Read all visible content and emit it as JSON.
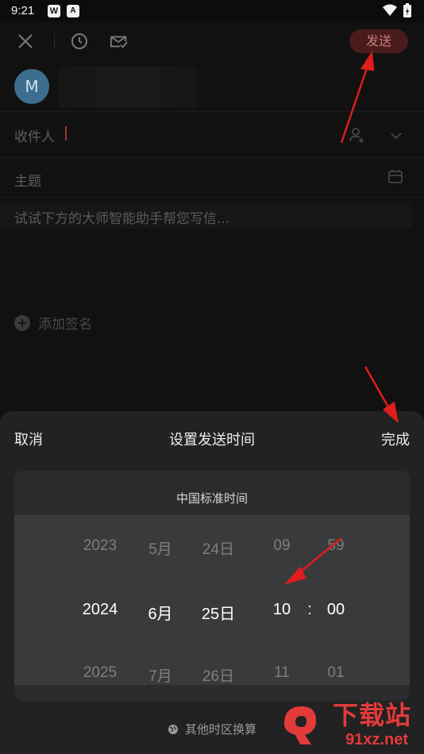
{
  "status_bar": {
    "time": "9:21",
    "app_icon_1": "W",
    "app_icon_2": "A"
  },
  "toolbar": {
    "send_label": "发送"
  },
  "sender": {
    "avatar_letter": "M"
  },
  "fields": {
    "recipient_label": "收件人",
    "subject_label": "主题",
    "body_placeholder": "试试下方的大师智能助手帮您写信...",
    "signature_label": "添加签名"
  },
  "sheet": {
    "cancel_label": "取消",
    "title": "设置发送时间",
    "done_label": "完成",
    "timezone_label": "中国标准时间",
    "timezone_convert_label": "其他时区换算",
    "wheels": {
      "years": [
        "2023",
        "2024",
        "2025"
      ],
      "months": [
        "5月",
        "6月",
        "7月"
      ],
      "days": [
        "24日",
        "25日",
        "26日"
      ],
      "hours": [
        "09",
        "10",
        "11"
      ],
      "colon": ":",
      "minutes": [
        "59",
        "00",
        "01"
      ]
    }
  },
  "watermark": {
    "top": "下载站",
    "bottom": "91xz.net"
  },
  "colors": {
    "accent_red": "#e33a3a",
    "send_bg": "#4a1b1b",
    "sheet_bg": "#222222"
  }
}
